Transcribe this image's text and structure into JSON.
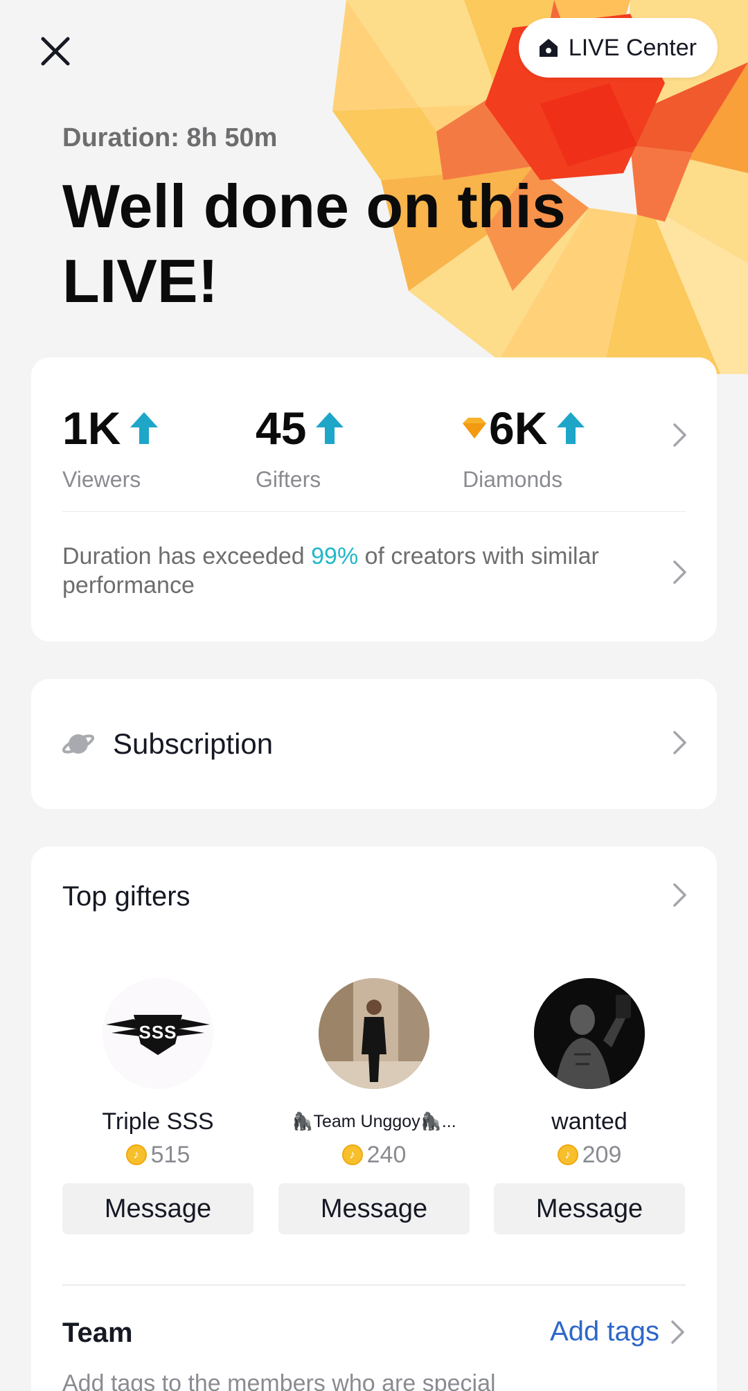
{
  "header": {
    "close_icon": "close-icon",
    "live_center": {
      "icon": "home-icon",
      "label": "LIVE Center"
    }
  },
  "summary": {
    "duration": "Duration: 8h 50m",
    "headline": "Well done on this LIVE!"
  },
  "stats": {
    "items": [
      {
        "value": "1K",
        "label": "Viewers",
        "trend": "up",
        "prefix_icon": ""
      },
      {
        "value": "45",
        "label": "Gifters",
        "trend": "up",
        "prefix_icon": ""
      },
      {
        "value": "6K",
        "label": "Diamonds",
        "trend": "up",
        "prefix_icon": "diamond-icon"
      }
    ],
    "performance": {
      "before": "Duration has exceeded ",
      "highlight": "99%",
      "after": " of creators with similar performance"
    }
  },
  "subscription": {
    "label": "Subscription",
    "icon": "planet-icon"
  },
  "top_gifters": {
    "title": "Top gifters",
    "gifters": [
      {
        "name": "Triple SSS",
        "coins": "515",
        "button": "Message"
      },
      {
        "name": "🦍Team Unggoy🦍...",
        "coins": "240",
        "button": "Message"
      },
      {
        "name": "wanted",
        "coins": "209",
        "button": "Message"
      }
    ]
  },
  "team": {
    "title": "Team",
    "action": "Add tags",
    "description": "Add tags to the members who are special"
  },
  "colors": {
    "accent_teal": "#20b8c8",
    "trend_arrow": "#1ea6c9",
    "link_blue": "#2d67c9",
    "coin_gold": "#f7bf2c"
  }
}
